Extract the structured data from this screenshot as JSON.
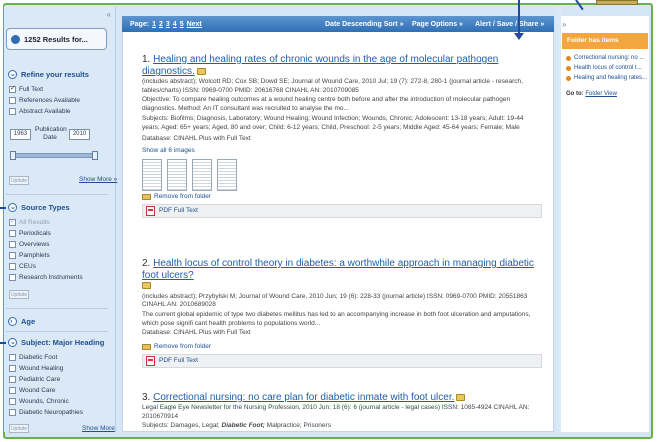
{
  "results_header": {
    "count_label": "1252 Results for..."
  },
  "refine": {
    "heading": "Refine your results",
    "options": [
      "Full Text",
      "References Available",
      "Abstract Available"
    ],
    "date_from": "1963",
    "date_to": "2010",
    "pub_date_label": "Publication Date",
    "update_label": "Update",
    "show_more": "Show More »"
  },
  "source_types": {
    "heading": "Source Types",
    "items": [
      "All Results",
      "Periodicals",
      "Overviews",
      "Pamphlets",
      "CEUs",
      "Research Instruments"
    ],
    "update_label": "Update"
  },
  "age": {
    "heading": "Age"
  },
  "subject": {
    "heading": "Subject: Major Heading",
    "items": [
      "Diabetic Foot",
      "Wound Healing",
      "Pediatric Care",
      "Wound Care",
      "Wounds, Chronic",
      "Diabetic Neuropathies"
    ],
    "update_label": "Update",
    "show_more": "Show More"
  },
  "toolbar": {
    "page_label": "Page:",
    "pages": [
      "1",
      "2",
      "3",
      "4",
      "5"
    ],
    "next": "Next",
    "sort": "Date Descending Sort »",
    "page_options": "Page Options »",
    "alert": "Alert / Save / Share »"
  },
  "results": [
    {
      "num": "1.",
      "title": "Healing and healing rates of chronic wounds in the age of molecular pathogen diagnostics.",
      "meta": "(includes abstract); Wolcott RD; Cox SB; Dowd SE; Journal of Wound Care, 2010 Jul; 19 (7): 272-8, 280-1 (journal article - research, tables/charts) ISSN: 0969-0700 PMID: 20616768 CINAHL AN: 2010709085",
      "abstract": "Objective: To compare healing outcomes at a wound healing centre both before and after the introduction of molecular pathogen diagnostics. Method: An IT consultant was recruited to analyse the mo...",
      "subjects": "Subjects: Biofilms; Diagnosis, Laboratory; Wound Healing; Wound Infection; Wounds, Chronic; Adolescent: 13-18 years; Adult: 19-44 years; Aged: 65+ years; Aged, 80 and over; Child: 6-12 years; Child, Preschool: 2-5 years; Middle Aged: 45-64 years; Female; Male",
      "database": "Database: CINAHL Plus with Full Text",
      "show_images": "Show all 6 images",
      "remove": "Remove from folder",
      "pdf": "PDF Full Text"
    },
    {
      "num": "2.",
      "title": "Health locus of control theory in diabetes: a worthwhile approach in managing diabetic foot ulcers?",
      "meta": "(includes abstract); Przybylski M; Journal of Wound Care, 2010 Jun; 19 (6): 228-33 (journal article) ISSN: 0969-0700 PMID: 20551863 CINAHL AN: 2010689028",
      "abstract": "The current global epidemic of type two diabetes mellitus has led to an accompanying increase in both foot ulceration and amputations, which pose signifi cant health problems to populations world...",
      "database": "Database: CINAHL Plus with Full Text",
      "remove": "Remove from folder",
      "pdf": "PDF Full Text"
    },
    {
      "num": "3.",
      "title": "Correctional nursing: no care plan for diabetic inmate with foot ulcer.",
      "meta": "Legal Eagle Eye Newsletter for the Nursing Profession, 2010 Jun; 18 (6): 6 (journal article - legal cases) ISSN: 1085-4924 CINAHL AN: 2010670914",
      "subjects_prefix": "Subjects: Damages, Legal; ",
      "subjects_em": "Diabetic Foot;",
      "subjects_suffix": " Malpractice; Prisoners"
    }
  ],
  "folder": {
    "heading": "Folder has items",
    "items": [
      "Correctional nursing: no ...",
      "Health locus of control t...",
      "Healing and healing rates..."
    ],
    "goto_label": "Go to:",
    "goto_link": "Folder View"
  },
  "colors": {
    "accent_blue": "#2f6fb4",
    "folder_orange": "#f2a63d",
    "frame_green": "#6ab04c"
  }
}
